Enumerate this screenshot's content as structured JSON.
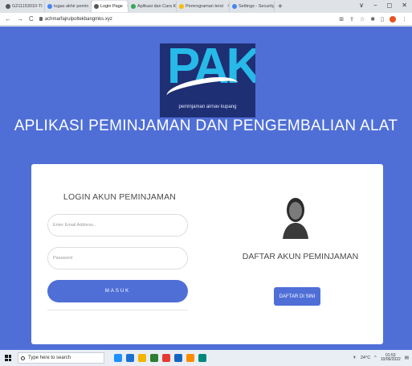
{
  "browser": {
    "tabs": [
      {
        "label": "G211153010-TI",
        "fav_color": "#555555"
      },
      {
        "label": "tugas akhir pemin",
        "fav_color": "#4285f4"
      },
      {
        "label": "Login Page",
        "fav_color": "#555555",
        "active": true
      },
      {
        "label": "Aplikasi dan Cara K",
        "fav_color": "#34a853"
      },
      {
        "label": "Pemrograman terst",
        "fav_color": "#fbbc05"
      },
      {
        "label": "Settings - Security",
        "fav_color": "#4285f4"
      }
    ],
    "new_tab_symbol": "+",
    "window_controls": [
      "∨",
      "−",
      "◻",
      "✕"
    ],
    "url": "achmarfajrulpoltekbangmks.xyz"
  },
  "header": {
    "logo_text": "PAK",
    "logo_tagline": "peminjaman airnav kupang",
    "app_title": "APLIKASI PEMINJAMAN DAN PENGEMBALIAN ALAT"
  },
  "login": {
    "title": "LOGIN AKUN PEMINJAMAN",
    "email_placeholder": "Enter Email Address...",
    "password_placeholder": "Password",
    "submit_label": "MASUK"
  },
  "register": {
    "title": "DAFTAR AKUN PEMINJAMAN",
    "button_label": "DAFTAR DI SINI"
  },
  "taskbar": {
    "search_placeholder": "Type here to search",
    "weather": "24°C",
    "time": "01:53",
    "date": "10/06/2022",
    "app_icon_colors": [
      "#1e90ff",
      "#1c6fd1",
      "#f4b400",
      "#2e7d32",
      "#e53935",
      "#1565c0",
      "#fb8c00",
      "#00897b"
    ]
  },
  "colors": {
    "primary": "#4f6fd7",
    "logo_bg": "#1f2f74",
    "logo_letters": "#27b9e8"
  }
}
